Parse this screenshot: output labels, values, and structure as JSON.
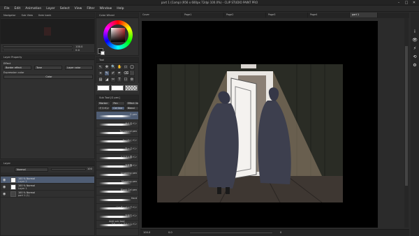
{
  "window": {
    "title": "part 1 (Comp) (956 x 600px 72dpi 100.0%) - CLIP STUDIO PAINT PRO",
    "minimize": "–",
    "maximize": "□",
    "close": "✕"
  },
  "menu": [
    "File",
    "Edit",
    "Animation",
    "Layer",
    "Select",
    "View",
    "Filter",
    "Window",
    "Help"
  ],
  "navigator": {
    "tab": "Navigator",
    "tab2": "Sub View",
    "tab3": "Item bank",
    "zoom": "100.0",
    "angle": "0.0"
  },
  "layer_property": {
    "tab": "Layer Property",
    "effect_label": "Effect",
    "border_effect": "Border effect",
    "tone": "Tone",
    "layer_color": "Layer color",
    "expression_label": "Expression color",
    "expression_value": "Color"
  },
  "layer_panel": {
    "tab": "Layer",
    "blend": "Normal",
    "opacity": "100",
    "layers": [
      {
        "name1": "100 % Normal",
        "name2": "Layer 2"
      },
      {
        "name1": "100 % Normal",
        "name2": "Layer 1"
      },
      {
        "name1": "100 % Normal",
        "name2": "part 1 (1)"
      }
    ]
  },
  "color_wheel": {
    "tab": "Color Wheel"
  },
  "tool_panel": {
    "tab": "Tool",
    "tools": [
      "↖",
      "✥",
      "🔍",
      "✋",
      "▭",
      "◯",
      "⌖",
      "✎",
      "✐",
      "✒",
      "⌫",
      "⬛",
      "▤",
      "◢",
      "✂",
      "T",
      "☐",
      "⚙",
      "✦",
      "⊹",
      "◐",
      "⬚",
      "✚",
      "⇄"
    ]
  },
  "sub_tool": {
    "tab": "Sub Tool [G pen]",
    "groups": [
      "Marker",
      "Pen",
      "Effect line"
    ],
    "groups2": [
      "ミリペン",
      "Cel line",
      "Blend"
    ],
    "brushes": [
      "G pen",
      "かえるペン",
      "Turnround pen",
      "わくわくペン",
      "ちっぷペン",
      "ミスマル雲ペン",
      "万年筆ペン",
      "Lingering pen",
      "Mapping pen",
      "Blank Cel pen",
      "Hard",
      "ジャギーインクペン",
      "お待ちペン",
      "ブラッシュプルームペン"
    ],
    "add_sub_tool": "Add sub tool"
  },
  "doc_tabs": [
    "Cover",
    "Page1",
    "Page2",
    "Page3",
    "Page4",
    "part 1"
  ],
  "status": {
    "zoom": "100.0",
    "angle": "0.0",
    "pos": "0"
  },
  "right_icons": [
    "i",
    "👁",
    "⚡",
    "⟲",
    "⚙"
  ],
  "colors": {
    "bg": "#2b2b2b",
    "canvas_bg": "#000000",
    "wall": "#2a2c25",
    "floor": "#3e3732",
    "light": "#b59d82",
    "cloak": "#3d3f4e",
    "accent_select": "#4f5d74"
  }
}
